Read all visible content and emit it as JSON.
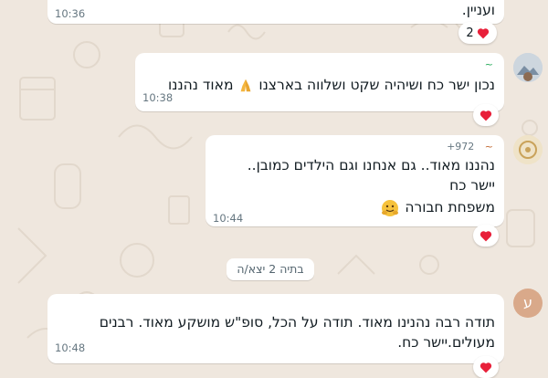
{
  "messages": [
    {
      "text": "ועניין.",
      "time": "10:36",
      "reaction_count": "2"
    },
    {
      "sender": "~ ",
      "phone": "",
      "text": "נכון ישר כח ושיהיה שקט ושלווה בארצנו",
      "text_tail": "מאוד נהננו",
      "time": "10:38"
    },
    {
      "sender": "~ ",
      "phone": "+972",
      "line1": "נהננו מאוד.. גם אנחנו וגם הילדים כמובן..",
      "line2": "יישר כח",
      "line3": "משפחת חבורה",
      "time": "10:44"
    },
    {
      "sender": "",
      "text": "תודה רבה נהנינו מאוד. תודה על הכל, סופ\"ש מושקע מאוד. רבנים\nמעולים.יישר כח.",
      "time": "10:48",
      "avatar_letter": "ע"
    }
  ],
  "date_separator": "בתיה 2 יצא/ה",
  "icons": {
    "reaction": "heart-icon",
    "praying": "praying-hands-emoji",
    "hug": "hugging-face-emoji"
  },
  "colors": {
    "background": "#efe7de",
    "bubble": "#ffffff",
    "heart": "#e8203a",
    "sender_green": "#1fa855",
    "avatar_orange": "#d9a98a"
  }
}
